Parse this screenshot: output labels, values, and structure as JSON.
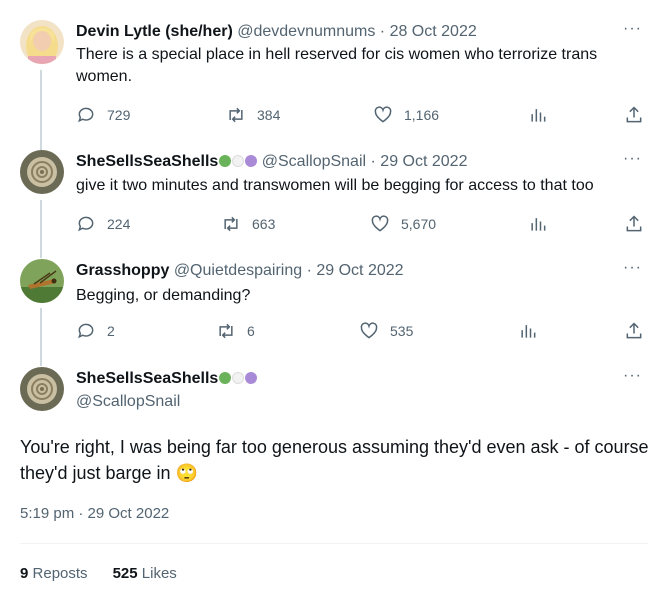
{
  "replies": [
    {
      "name": "Devin Lytle (she/her)",
      "handle": "@devdevnumnums",
      "date": "28 Oct 2022",
      "text": "There is a special place in hell reserved for cis women who terrorize trans women.",
      "replies": "729",
      "reposts": "384",
      "likes": "1,166"
    },
    {
      "name": "SheSellsSeaShells",
      "handle": "@ScallopSnail",
      "date": "29 Oct 2022",
      "text": "give it two minutes and transwomen will be begging for access to that too",
      "replies": "224",
      "reposts": "663",
      "likes": "5,670"
    },
    {
      "name": "Grasshoppy",
      "handle": "@Quietdespairing",
      "date": "29 Oct 2022",
      "text": "Begging, or demanding?",
      "replies": "2",
      "reposts": "6",
      "likes": "535"
    }
  ],
  "main": {
    "name": "SheSellsSeaShells",
    "handle": "@ScallopSnail",
    "text": "You're right, I was being far too generous assuming they'd even ask - of course they'd just barge in",
    "emoji": "🙄",
    "timestamp": "5:19 pm · 29 Oct 2022",
    "reposts_count": "9",
    "reposts_label": "Reposts",
    "likes_count": "525",
    "likes_label": "Likes"
  },
  "separator": "·",
  "more_icon": "···",
  "icons": [
    "reply-icon",
    "repost-icon",
    "like-icon",
    "views-icon",
    "share-icon",
    "more-icon"
  ],
  "colors": {
    "heart_green": "#6bb35a",
    "heart_white": "#f2f2f2",
    "heart_purple": "#a98ad6",
    "secondary_text": "#536471"
  }
}
